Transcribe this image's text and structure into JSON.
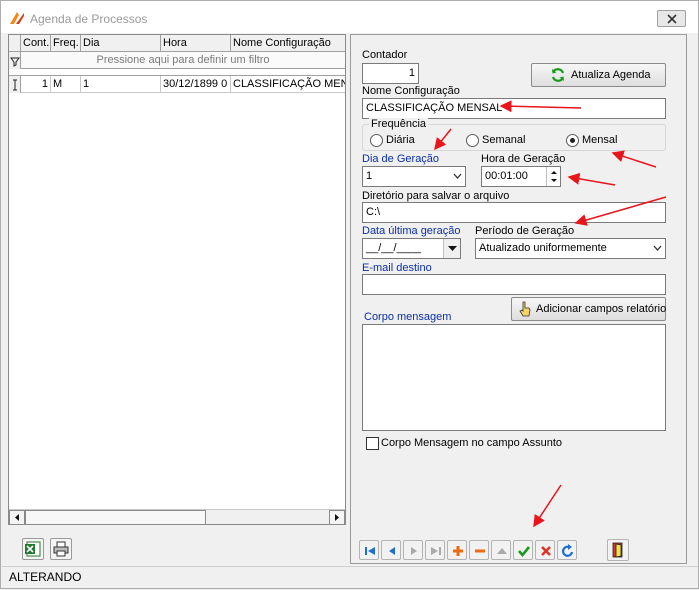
{
  "window": {
    "title": "Agenda de Processos"
  },
  "grid": {
    "columns": [
      "Cont.",
      "Freq.",
      "Dia",
      "Hora",
      "Nome Configuração"
    ],
    "filter_hint": "Pressione aqui para definir um filtro",
    "row": {
      "cont": "1",
      "freq": "M",
      "dia": "1",
      "hora": "30/12/1899 0",
      "nome": "CLASSIFICAÇÃO MENSAL"
    }
  },
  "form": {
    "contador_label": "Contador",
    "contador_value": "1",
    "atualiza_button": "Atualiza Agenda",
    "nome_label": "Nome Configuração",
    "nome_value": "CLASSIFICAÇÃO MENSAL",
    "frequencia_label": "Frequência",
    "freq_options": [
      "Diária",
      "Semanal",
      "Mensal"
    ],
    "freq_selected": "Mensal",
    "dia_label": "Dia de Geração",
    "dia_value": "1",
    "hora_label": "Hora de Geração",
    "hora_value": "00:01:00",
    "diretorio_label": "Diretório para salvar o arquivo",
    "diretorio_value": "C:\\",
    "data_label": "Data última geração",
    "data_value": "__/__/____",
    "periodo_label": "Período de Geração",
    "periodo_value": "Atualizado uniformemente",
    "email_label": "E-mail destino",
    "email_value": "",
    "adicionar_button": "Adicionar campos relatório",
    "corpo_label": "Corpo mensagem",
    "corpo_value": "",
    "checkbox_label": "Corpo Mensagem no campo Assunto"
  },
  "status": {
    "text": "ALTERANDO"
  },
  "colors": {
    "accent_blue": "#0b2fa6",
    "arrow_red": "#e8151b",
    "nav_blue": "#1f6fd1",
    "nav_red": "#e0342a",
    "nav_green": "#1a9a1a",
    "nav_orange": "#ef6b12"
  },
  "icons": [
    "app-logo-icon",
    "close-icon",
    "refresh-icon",
    "excel-icon",
    "print-icon",
    "hand-pointer-icon",
    "exit-door-icon"
  ]
}
